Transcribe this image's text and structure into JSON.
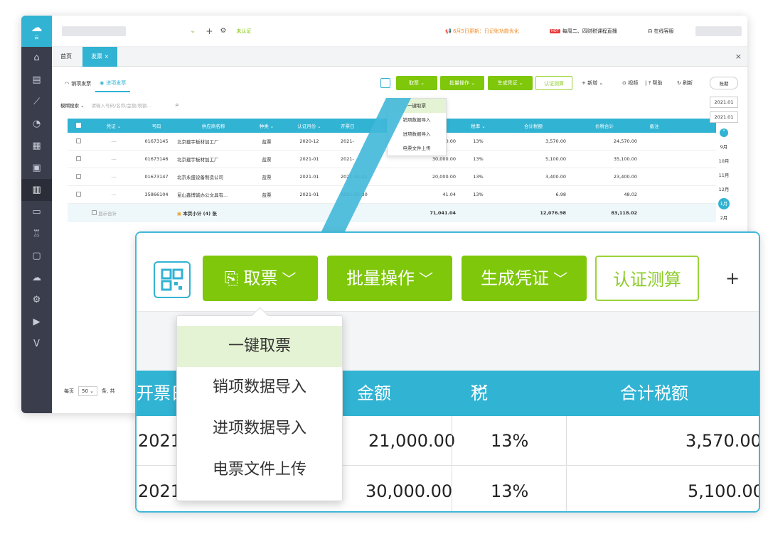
{
  "topbar": {
    "unauth_label": "未认证",
    "notice": "6月5日更新：日记账功能优化",
    "live_tag": "HOT",
    "live": "每周二、四财税课程直播",
    "service": "在线客服"
  },
  "tabs": {
    "home": "首页",
    "invoice": "发票"
  },
  "subtabs": {
    "sales": "销项发票",
    "input": "进项发票"
  },
  "toolbar": {
    "fetch": "取票",
    "batch": "批量操作",
    "voucher": "生成凭证",
    "certify": "认证测算",
    "add": "+ 新增",
    "video": "视频",
    "help": "帮助",
    "refresh": "刷新"
  },
  "search": {
    "mode": "模糊搜索",
    "placeholder": "请输入号码/名称/金额/税额..."
  },
  "fetch_menu": [
    "一键取票",
    "销项数据导入",
    "进项数据导入",
    "电票文件上传"
  ],
  "table": {
    "headers": [
      "凭证",
      "号码",
      "供应商名称",
      "种类",
      "认证月份",
      "开票日",
      "金额",
      "税率",
      "合计税额",
      "价税合计",
      "备注"
    ],
    "rows": [
      {
        "voucher": "---",
        "number": "01673145",
        "supplier": "北京建宇板材加工厂",
        "type": "蓝票",
        "month": "2020-12",
        "date": "2021-",
        "amount": "21,000.00",
        "rate": "13%",
        "tax": "3,570.00",
        "total": "24,570.00"
      },
      {
        "voucher": "---",
        "number": "01673146",
        "supplier": "北京建宇板材加工厂",
        "type": "蓝票",
        "month": "2021-01",
        "date": "2021-",
        "amount": "30,000.00",
        "rate": "13%",
        "tax": "5,100.00",
        "total": "35,100.00"
      },
      {
        "voucher": "---",
        "number": "01673147",
        "supplier": "北京永盛设备制造公司",
        "type": "蓝票",
        "month": "2021-01",
        "date": "2021-01-22",
        "amount": "20,000.00",
        "rate": "13%",
        "tax": "3,400.00",
        "total": "23,400.00"
      },
      {
        "voucher": "---",
        "number": "35866104",
        "supplier": "昆山鑫博诚办公文具有...",
        "type": "蓝票",
        "month": "2021-01",
        "date": "2021-01-30",
        "amount": "41.04",
        "rate": "13%",
        "tax": "6.98",
        "total": "48.02"
      }
    ],
    "summary": {
      "show_total": "显示合计",
      "subtotal": "本页小计 (4) 张",
      "amount": "71,041.04",
      "tax": "12,076.98",
      "total": "83,118.02"
    }
  },
  "dates": {
    "period": "账期",
    "from": "2021.01",
    "to": "2021.01",
    "months": [
      "9月",
      "10月",
      "11月",
      "12月"
    ],
    "year_badge": "2021",
    "selected": "1月",
    "next": "2月"
  },
  "pager": {
    "label": "每页",
    "size": "50",
    "unit": "条, 共"
  },
  "zoom": {
    "fetch": "取票",
    "batch": "批量操作",
    "voucher": "生成凭证",
    "certify": "认证测算",
    "add_partial": "+ 新",
    "headers": {
      "date": "开票日",
      "amount": "金额",
      "rate": "税率",
      "tax": "合计税额"
    },
    "rows": [
      {
        "date": "2021",
        "amount": "21,000.00",
        "rate": "13%",
        "tax": "3,570.00"
      },
      {
        "date": "2021",
        "amount": "30,000.00",
        "rate": "13%",
        "tax": "5,100.00"
      }
    ],
    "menu": [
      "一键取票",
      "销项数据导入",
      "进项数据导入",
      "电票文件上传"
    ]
  }
}
